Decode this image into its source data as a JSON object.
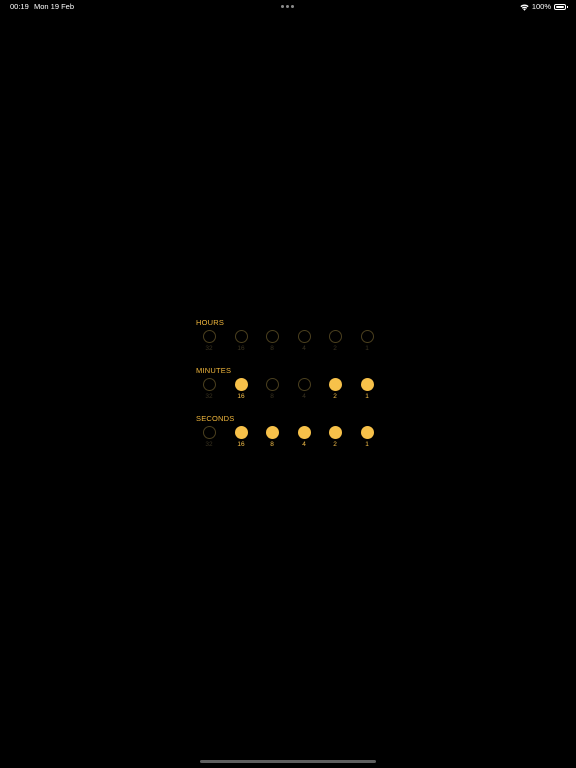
{
  "status_bar": {
    "time": "00:19",
    "date": "Mon 19 Feb",
    "battery": "100%",
    "wifi_icon": "wifi-icon",
    "battery_icon": "battery-icon",
    "multitasking_icon": "multitasking-dots-icon"
  },
  "colors": {
    "accent": "#f7c14a",
    "label": "#f0b63c",
    "off_ring": "#4a3f1e",
    "off_text": "#3a3320",
    "background": "#000000"
  },
  "clock": {
    "hours": {
      "label": "HOURS",
      "bits": [
        {
          "value": "32",
          "on": false
        },
        {
          "value": "16",
          "on": false
        },
        {
          "value": "8",
          "on": false
        },
        {
          "value": "4",
          "on": false
        },
        {
          "value": "2",
          "on": false
        },
        {
          "value": "1",
          "on": false
        }
      ]
    },
    "minutes": {
      "label": "MINUTES",
      "bits": [
        {
          "value": "32",
          "on": false
        },
        {
          "value": "16",
          "on": true
        },
        {
          "value": "8",
          "on": false
        },
        {
          "value": "4",
          "on": false
        },
        {
          "value": "2",
          "on": true
        },
        {
          "value": "1",
          "on": true
        }
      ]
    },
    "seconds": {
      "label": "SECONDS",
      "bits": [
        {
          "value": "32",
          "on": false
        },
        {
          "value": "16",
          "on": true
        },
        {
          "value": "8",
          "on": true
        },
        {
          "value": "4",
          "on": true
        },
        {
          "value": "2",
          "on": true
        },
        {
          "value": "1",
          "on": true
        }
      ]
    }
  }
}
